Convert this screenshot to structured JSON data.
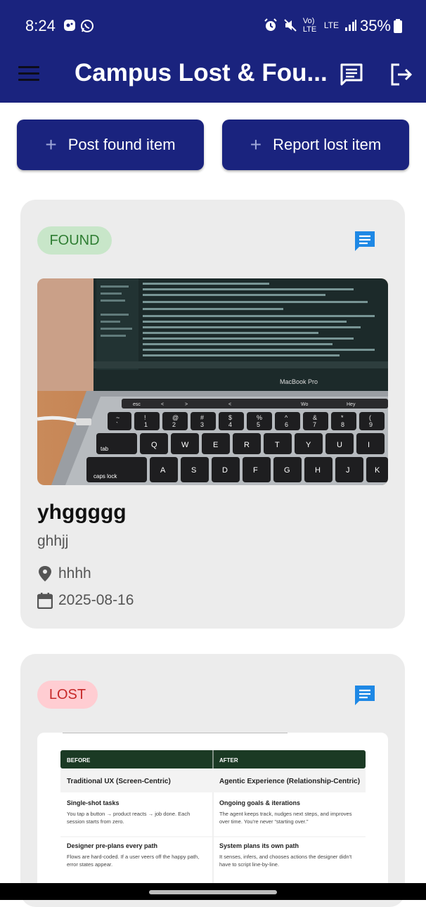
{
  "status_bar": {
    "time": "8:24",
    "network_label": "Vo) LTE",
    "lte_label": "LTE",
    "battery": "35%"
  },
  "app_bar": {
    "title": "Campus Lost & Fou...",
    "icons": [
      "menu-icon",
      "chat-icon",
      "logout-icon"
    ]
  },
  "actions": {
    "post_found": "Post found item",
    "report_lost": "Report lost item"
  },
  "items": [
    {
      "status": "FOUND",
      "status_color": "#2e7d32",
      "status_bg": "#c8e6c9",
      "title": "yhggggg",
      "description": "ghhjj",
      "location": "hhhh",
      "date": "2025-08-16",
      "photo_text": {
        "brand": "MacBook Pro",
        "keys_row1": [
          "esc",
          "<",
          ">",
          "<",
          "Wo",
          "Hey"
        ],
        "keys_row2": [
          "~",
          "!",
          "@",
          "#",
          "$",
          "%",
          "^",
          "&",
          "*",
          "("
        ],
        "keys_row2b": [
          "`",
          "1",
          "2",
          "3",
          "4",
          "5",
          "6",
          "7",
          "8",
          "9"
        ],
        "keys_row3": [
          "tab",
          "Q",
          "W",
          "E",
          "R",
          "T",
          "Y",
          "U",
          "I"
        ],
        "keys_row4": [
          "caps lock",
          "A",
          "S",
          "D",
          "F",
          "G",
          "H",
          "J",
          "K"
        ]
      }
    },
    {
      "status": "LOST",
      "status_color": "#c62828",
      "status_bg": "#ffcdd2",
      "photo_text": {
        "col1_header": "BEFORE",
        "col2_header": "AFTER",
        "col1_title": "Traditional UX (Screen-Centric)",
        "col2_title": "Agentic Experience (Relationship-Centric)",
        "r1_c1_title": "Single-shot tasks",
        "r1_c1_body": "You tap a button → product reacts → job done. Each session starts from zero.",
        "r1_c2_title": "Ongoing goals & iterations",
        "r1_c2_body": "The agent keeps track, nudges next steps, and improves over time. You're never “starting over.”",
        "r2_c1_title": "Designer pre-plans every path",
        "r2_c1_body": "Flows are hard-coded. If a user veers off the happy path, error states appear.",
        "r2_c2_title": "System plans its own path",
        "r2_c2_body": "It senses, infers, and chooses actions the designer didn't have to script line-by-line."
      }
    }
  ]
}
